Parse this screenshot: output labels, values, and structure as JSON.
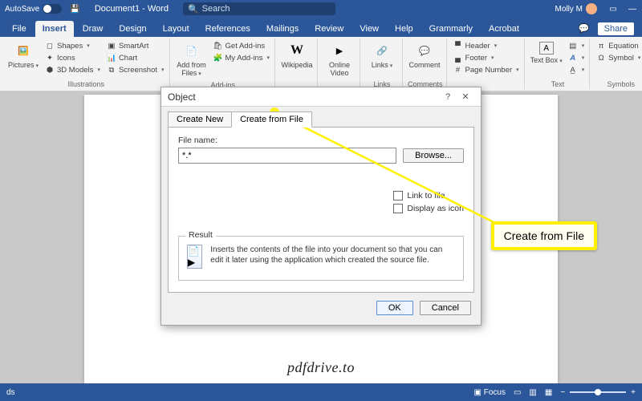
{
  "title": {
    "autosave_label": "AutoSave",
    "doc_title": "Document1 - Word",
    "search_placeholder": "Search",
    "user_name": "Molly M"
  },
  "tabs": {
    "items": [
      "File",
      "Insert",
      "Draw",
      "Design",
      "Layout",
      "References",
      "Mailings",
      "Review",
      "View",
      "Help",
      "Grammarly",
      "Acrobat"
    ],
    "active_index": 1,
    "share": "Share"
  },
  "ribbon": {
    "illustrations": {
      "label": "Illustrations",
      "pictures": "Pictures",
      "shapes": "Shapes",
      "icons": "Icons",
      "models": "3D Models",
      "smartart": "SmartArt",
      "chart": "Chart",
      "screenshot": "Screenshot"
    },
    "addins": {
      "label": "Add-ins",
      "add_from_files": "Add from Files",
      "get": "Get Add-ins",
      "my": "My Add-ins"
    },
    "media": {
      "wikipedia": "Wikipedia",
      "online_video": "Online Video"
    },
    "links": {
      "label": "Links",
      "links": "Links"
    },
    "comments": {
      "label": "Comments",
      "comment": "Comment"
    },
    "headerfooter": {
      "header": "Header",
      "footer": "Footer",
      "pagenum": "Page Number"
    },
    "text": {
      "label": "Text",
      "textbox": "Text Box",
      "a": "A"
    },
    "symbols": {
      "label": "Symbols",
      "equation": "Equation",
      "symbol": "Symbol"
    }
  },
  "dialog": {
    "title": "Object",
    "tab_new": "Create New",
    "tab_file": "Create from File",
    "file_name_label": "File name:",
    "file_name_value": "*.*",
    "browse": "Browse...",
    "link": "Link to file",
    "display_icon": "Display as icon",
    "result_label": "Result",
    "result_text": "Inserts the contents of the file into your document so that you can edit it later using the application which created the source file.",
    "ok": "OK",
    "cancel": "Cancel"
  },
  "callout": {
    "text": "Create from File"
  },
  "status": {
    "focus": "Focus",
    "left": "ds"
  },
  "watermark": "pdfdrive.to"
}
